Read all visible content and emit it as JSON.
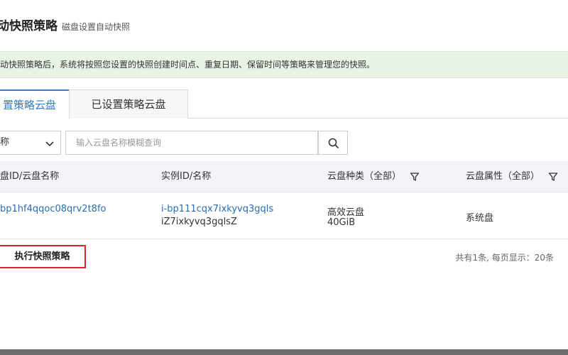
{
  "header": {
    "title": "动快照策略",
    "subtitle": "磁盘设置自动快照"
  },
  "info": {
    "text": "动快照策略后，系统将按照您设置的快照创建时间点、重复日期、保留时间等策略来管理您的快照。"
  },
  "tabs": [
    {
      "label": "置策略云盘",
      "active": true
    },
    {
      "label": "已设置策略云盘",
      "active": false
    }
  ],
  "search": {
    "select_value": "称",
    "placeholder": "输入云盘名称模糊查询"
  },
  "table": {
    "headers": [
      "盘ID/云盘名称",
      "实例ID/名称",
      "云盘种类（全部）",
      "云盘属性（全部）"
    ],
    "rows": [
      {
        "disk_id": "bp1hf4qqoc08qrv2t8fo",
        "instance_id": "i-bp111cqx7ixkyvq3gqls",
        "instance_name": "iZ7ixkyvq3gqlsZ",
        "disk_type": "高效云盘",
        "disk_size": "40GiB",
        "disk_attr": "系统盘"
      }
    ]
  },
  "footer": {
    "execute_label": "执行快照策略",
    "pager": "共有1条, 每页显示：20条"
  },
  "colors": {
    "accent": "#2b7fd4",
    "link": "#2b6cb0",
    "info_bg": "#e9f4e7",
    "highlight": "#d9252b"
  }
}
